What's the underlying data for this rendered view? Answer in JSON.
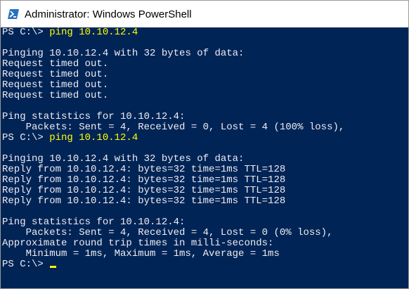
{
  "window": {
    "title": "Administrator: Windows PowerShell",
    "icon": "powershell-icon"
  },
  "console": {
    "background": "#012456",
    "text_color": "#eeedf0",
    "command_color": "#ffff00",
    "lines": [
      {
        "prompt": "PS C:\\> ",
        "command": "ping 10.10.12.4",
        "text": ""
      },
      {
        "prompt": "",
        "command": "",
        "text": ""
      },
      {
        "prompt": "",
        "command": "",
        "text": "Pinging 10.10.12.4 with 32 bytes of data:"
      },
      {
        "prompt": "",
        "command": "",
        "text": "Request timed out."
      },
      {
        "prompt": "",
        "command": "",
        "text": "Request timed out."
      },
      {
        "prompt": "",
        "command": "",
        "text": "Request timed out."
      },
      {
        "prompt": "",
        "command": "",
        "text": "Request timed out."
      },
      {
        "prompt": "",
        "command": "",
        "text": ""
      },
      {
        "prompt": "",
        "command": "",
        "text": "Ping statistics for 10.10.12.4:"
      },
      {
        "prompt": "",
        "command": "",
        "text": "    Packets: Sent = 4, Received = 0, Lost = 4 (100% loss),"
      },
      {
        "prompt": "PS C:\\> ",
        "command": "ping 10.10.12.4",
        "text": ""
      },
      {
        "prompt": "",
        "command": "",
        "text": ""
      },
      {
        "prompt": "",
        "command": "",
        "text": "Pinging 10.10.12.4 with 32 bytes of data:"
      },
      {
        "prompt": "",
        "command": "",
        "text": "Reply from 10.10.12.4: bytes=32 time=1ms TTL=128"
      },
      {
        "prompt": "",
        "command": "",
        "text": "Reply from 10.10.12.4: bytes=32 time=1ms TTL=128"
      },
      {
        "prompt": "",
        "command": "",
        "text": "Reply from 10.10.12.4: bytes=32 time=1ms TTL=128"
      },
      {
        "prompt": "",
        "command": "",
        "text": "Reply from 10.10.12.4: bytes=32 time=1ms TTL=128"
      },
      {
        "prompt": "",
        "command": "",
        "text": ""
      },
      {
        "prompt": "",
        "command": "",
        "text": "Ping statistics for 10.10.12.4:"
      },
      {
        "prompt": "",
        "command": "",
        "text": "    Packets: Sent = 4, Received = 4, Lost = 0 (0% loss),"
      },
      {
        "prompt": "",
        "command": "",
        "text": "Approximate round trip times in milli-seconds:"
      },
      {
        "prompt": "",
        "command": "",
        "text": "    Minimum = 1ms, Maximum = 1ms, Average = 1ms"
      },
      {
        "prompt": "PS C:\\> ",
        "command": "",
        "text": "",
        "cursor": true
      }
    ]
  }
}
